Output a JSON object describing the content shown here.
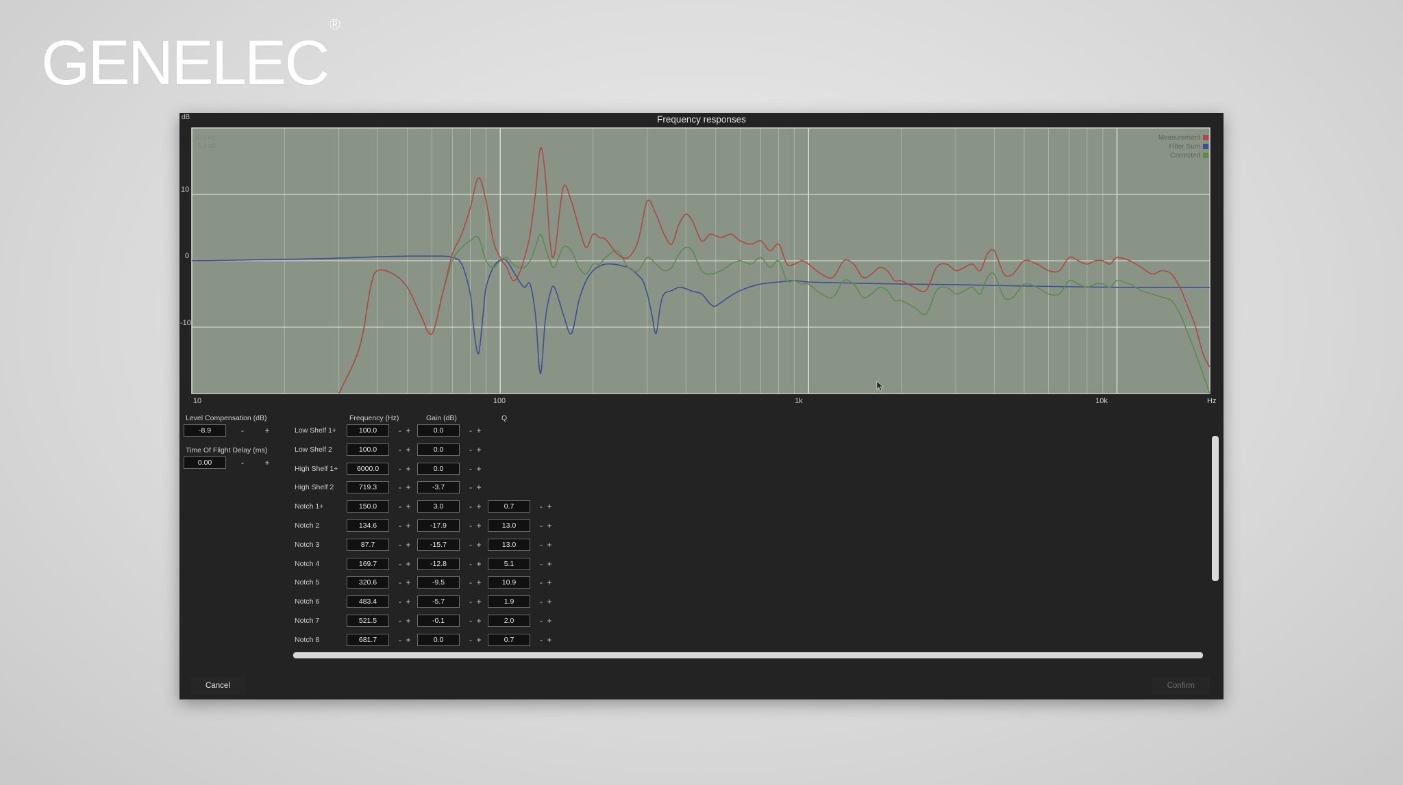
{
  "brand": {
    "name": "GENELEC",
    "mark": "®"
  },
  "window": {
    "title": "Frequency responses",
    "y_unit": "dB",
    "readout": {
      "freq": "472 Hz",
      "gain": "-1.3 dB"
    },
    "legend": [
      {
        "label": "Measurement",
        "color": "#a94a45"
      },
      {
        "label": "Filter Sum",
        "color": "#3d4f8f"
      },
      {
        "label": "Corrected",
        "color": "#5e8a52"
      }
    ],
    "y_ticks": [
      "10",
      "0",
      "-10"
    ],
    "x_ticks": [
      "10",
      "100",
      "1k",
      "10k"
    ],
    "x_unit": "Hz"
  },
  "chart_data": {
    "type": "line",
    "x_scale": "log",
    "xlim": [
      10,
      20000
    ],
    "ylim": [
      -20,
      20
    ],
    "grid": true,
    "legend_position": "top-right",
    "series": [
      {
        "name": "Measurement",
        "color": "#a94a45",
        "x": [
          30,
          35,
          38,
          40,
          45,
          50,
          55,
          60,
          65,
          70,
          75,
          80,
          85,
          90,
          95,
          100,
          105,
          110,
          115,
          120,
          125,
          130,
          135,
          140,
          145,
          150,
          160,
          170,
          180,
          190,
          200,
          210,
          220,
          240,
          260,
          280,
          300,
          320,
          340,
          360,
          380,
          400,
          420,
          450,
          480,
          520,
          560,
          600,
          650,
          700,
          750,
          800,
          850,
          900,
          950,
          1000,
          1100,
          1200,
          1300,
          1400,
          1500,
          1600,
          1700,
          1800,
          1900,
          2000,
          2200,
          2400,
          2600,
          2800,
          3000,
          3200,
          3400,
          3600,
          3800,
          4000,
          4300,
          4600,
          5000,
          5500,
          6000,
          6500,
          7000,
          7500,
          8000,
          8500,
          9000,
          9500,
          10000,
          11000,
          12000,
          13000,
          14000,
          15000,
          16000,
          17000,
          18000,
          19000,
          20000
        ],
        "y": [
          -20,
          -13,
          -4,
          -1.5,
          -2,
          -4,
          -8,
          -11,
          -5,
          1,
          4,
          8,
          12.5,
          9,
          3,
          0.5,
          -1,
          -3,
          -2,
          0.5,
          4,
          10,
          17,
          13,
          3,
          1,
          11,
          9,
          5,
          2,
          4,
          3.5,
          3.2,
          1,
          0.5,
          3,
          9,
          7,
          4,
          2.5,
          5.5,
          7,
          6,
          3,
          4,
          3.5,
          4,
          3,
          2.5,
          3,
          1.5,
          2.5,
          -0.5,
          -0.5,
          0,
          -0.5,
          -2,
          -2.5,
          0,
          -0.5,
          -2.5,
          -2,
          -1,
          -1.5,
          -3,
          -3,
          -4,
          -4.5,
          -1,
          -0.5,
          -1.5,
          -1,
          -0.5,
          -1.5,
          1,
          1.5,
          -2,
          -2,
          0,
          -0.5,
          -1.5,
          -1.5,
          0.5,
          0,
          -0.5,
          0,
          0,
          -0.5,
          0.5,
          0,
          -1,
          -2,
          -1.5,
          -2,
          -4,
          -7,
          -10,
          -14,
          -16
        ]
      },
      {
        "name": "Filter Sum",
        "color": "#3d4f8f",
        "x": [
          10,
          20,
          30,
          40,
          50,
          60,
          65,
          70,
          75,
          80,
          82,
          85,
          88,
          90,
          95,
          100,
          105,
          110,
          115,
          120,
          125,
          130,
          135,
          140,
          145,
          150,
          160,
          170,
          180,
          190,
          200,
          210,
          220,
          230,
          240,
          250,
          260,
          270,
          280,
          290,
          300,
          310,
          320,
          330,
          340,
          360,
          380,
          400,
          420,
          450,
          480,
          500,
          550,
          600,
          650,
          700,
          800,
          900,
          1000,
          1200,
          1500,
          2000,
          3000,
          5000,
          10000,
          20000
        ],
        "y": [
          0,
          0.2,
          0.4,
          0.6,
          0.7,
          0.7,
          0.7,
          0.5,
          -0.5,
          -5,
          -10,
          -14,
          -8,
          -4,
          -1,
          0.1,
          0,
          -1.5,
          -3,
          -4,
          -3.5,
          -8,
          -17,
          -9,
          -5,
          -4,
          -8,
          -11,
          -6,
          -3,
          -1.5,
          -0.8,
          -0.5,
          -0.5,
          -0.6,
          -0.8,
          -1,
          -1.5,
          -2.2,
          -3,
          -5,
          -8,
          -11,
          -7,
          -5,
          -4.5,
          -4,
          -4.2,
          -4.6,
          -5,
          -6.5,
          -6.8,
          -5.5,
          -4.5,
          -3.9,
          -3.5,
          -3.2,
          -3,
          -3.2,
          -3.3,
          -3.4,
          -3.5,
          -3.6,
          -3.8,
          -4,
          -4
        ]
      },
      {
        "name": "Corrected",
        "color": "#5e8a52",
        "x": [
          30,
          35,
          38,
          40,
          45,
          50,
          55,
          60,
          65,
          70,
          75,
          80,
          85,
          90,
          95,
          100,
          105,
          110,
          115,
          120,
          125,
          130,
          135,
          140,
          145,
          150,
          160,
          170,
          180,
          190,
          200,
          210,
          220,
          240,
          260,
          280,
          300,
          320,
          340,
          360,
          380,
          400,
          420,
          450,
          480,
          520,
          560,
          600,
          650,
          700,
          750,
          800,
          850,
          900,
          950,
          1000,
          1100,
          1200,
          1300,
          1400,
          1500,
          1600,
          1700,
          1800,
          1900,
          2000,
          2200,
          2400,
          2600,
          2800,
          3000,
          3200,
          3400,
          3600,
          3800,
          4000,
          4300,
          4600,
          5000,
          5500,
          6000,
          6500,
          7000,
          7500,
          8000,
          8500,
          9000,
          9500,
          10000,
          11000,
          12000,
          13000,
          14000,
          15000,
          16000,
          17000,
          18000,
          19000,
          20000
        ],
        "y": [
          -20,
          -13,
          -4,
          -1.5,
          -2,
          -4,
          -8,
          -11,
          -5,
          0,
          2,
          3,
          3.5,
          0,
          -1,
          0,
          0.5,
          -0.5,
          -1,
          -1,
          0,
          2,
          4,
          2,
          0,
          -1,
          2,
          1.5,
          -1,
          -2,
          -0.5,
          -0.5,
          0.5,
          1.5,
          -1,
          -1.5,
          0.5,
          -0.5,
          -1.5,
          -1,
          1,
          2,
          1.5,
          -1.5,
          -2,
          -1.5,
          -0.5,
          0,
          -0.5,
          0.5,
          -1,
          0,
          -3,
          -3,
          -3.5,
          -3.5,
          -5,
          -5.5,
          -3,
          -3.5,
          -5.5,
          -5,
          -4,
          -4.5,
          -6,
          -6,
          -7,
          -8,
          -4.5,
          -4,
          -5,
          -4.5,
          -4,
          -5,
          -2.5,
          -2,
          -5.5,
          -5.5,
          -3.5,
          -4,
          -5,
          -5,
          -3,
          -3.5,
          -4,
          -3.5,
          -3.5,
          -4,
          -3,
          -3.5,
          -4.5,
          -5,
          -5.5,
          -6,
          -8,
          -11,
          -14,
          -17,
          -20
        ]
      }
    ]
  },
  "panel": {
    "level_comp": {
      "label": "Level Compensation (dB)",
      "value": "-8.9"
    },
    "tof_delay": {
      "label": "Time Of Flight Delay (ms)",
      "value": "0.00"
    },
    "minus": "-",
    "plus": "+",
    "columns": {
      "frequency": "Frequency (Hz)",
      "gain": "Gain (dB)",
      "q": "Q"
    },
    "filters": [
      {
        "name": "Low Shelf 1+",
        "freq": "100.0",
        "gain": "0.0",
        "q": ""
      },
      {
        "name": "Low Shelf 2",
        "freq": "100.0",
        "gain": "0.0",
        "q": ""
      },
      {
        "name": "High Shelf 1+",
        "freq": "6000.0",
        "gain": "0.0",
        "q": ""
      },
      {
        "name": "High Shelf 2",
        "freq": "719.3",
        "gain": "-3.7",
        "q": ""
      },
      {
        "name": "Notch 1+",
        "freq": "150.0",
        "gain": "3.0",
        "q": "0.7"
      },
      {
        "name": "Notch 2",
        "freq": "134.6",
        "gain": "-17.9",
        "q": "13.0"
      },
      {
        "name": "Notch 3",
        "freq": "87.7",
        "gain": "-15.7",
        "q": "13.0"
      },
      {
        "name": "Notch 4",
        "freq": "169.7",
        "gain": "-12.8",
        "q": "5.1"
      },
      {
        "name": "Notch 5",
        "freq": "320.6",
        "gain": "-9.5",
        "q": "10.9"
      },
      {
        "name": "Notch 6",
        "freq": "483.4",
        "gain": "-5.7",
        "q": "1.9"
      },
      {
        "name": "Notch 7",
        "freq": "521.5",
        "gain": "-0.1",
        "q": "2.0"
      },
      {
        "name": "Notch 8",
        "freq": "681.7",
        "gain": "0.0",
        "q": "0.7"
      }
    ],
    "cancel_label": "Cancel",
    "confirm_label": "Confirm"
  }
}
